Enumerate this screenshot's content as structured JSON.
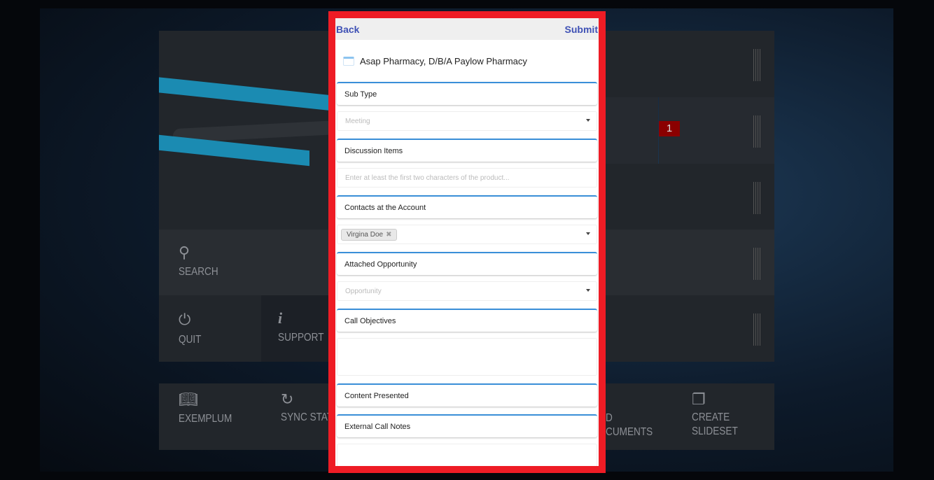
{
  "header": {
    "back_label": "Back",
    "submit_label": "Submit"
  },
  "account": {
    "name": "Asap Pharmacy, D/B/A Paylow Pharmacy",
    "icon": "document-icon"
  },
  "form": {
    "sub_type": {
      "label": "Sub Type",
      "placeholder": "Meeting"
    },
    "discussion_items": {
      "label": "Discussion Items",
      "placeholder": "Enter at least the first two characters of the product..."
    },
    "contacts": {
      "label": "Contacts at the Account",
      "selected": [
        "Virgina Doe"
      ],
      "remove_glyph": "✖"
    },
    "opportunity": {
      "label": "Attached Opportunity",
      "placeholder": "Opportunity"
    },
    "call_objectives": {
      "label": "Call Objectives",
      "value": ""
    },
    "content_presented": {
      "label": "Content Presented"
    },
    "external_call_notes": {
      "label": "External Call Notes"
    }
  },
  "background": {
    "tiles": {
      "search": "SEARCH",
      "quit": "QUIT",
      "support": "SUPPORT",
      "exemplum": "EXEMPLUM",
      "sync_status": "SYNC STATUS",
      "documents": "D\nCUMENTS",
      "create_slideset_1": "CREATE",
      "create_slideset_2": "SLIDESET"
    },
    "badge": "1"
  },
  "colors": {
    "frame": "#ee1c25",
    "accent": "#3f51b5",
    "section_border": "#3a8fd8",
    "badge": "#8b0000"
  }
}
